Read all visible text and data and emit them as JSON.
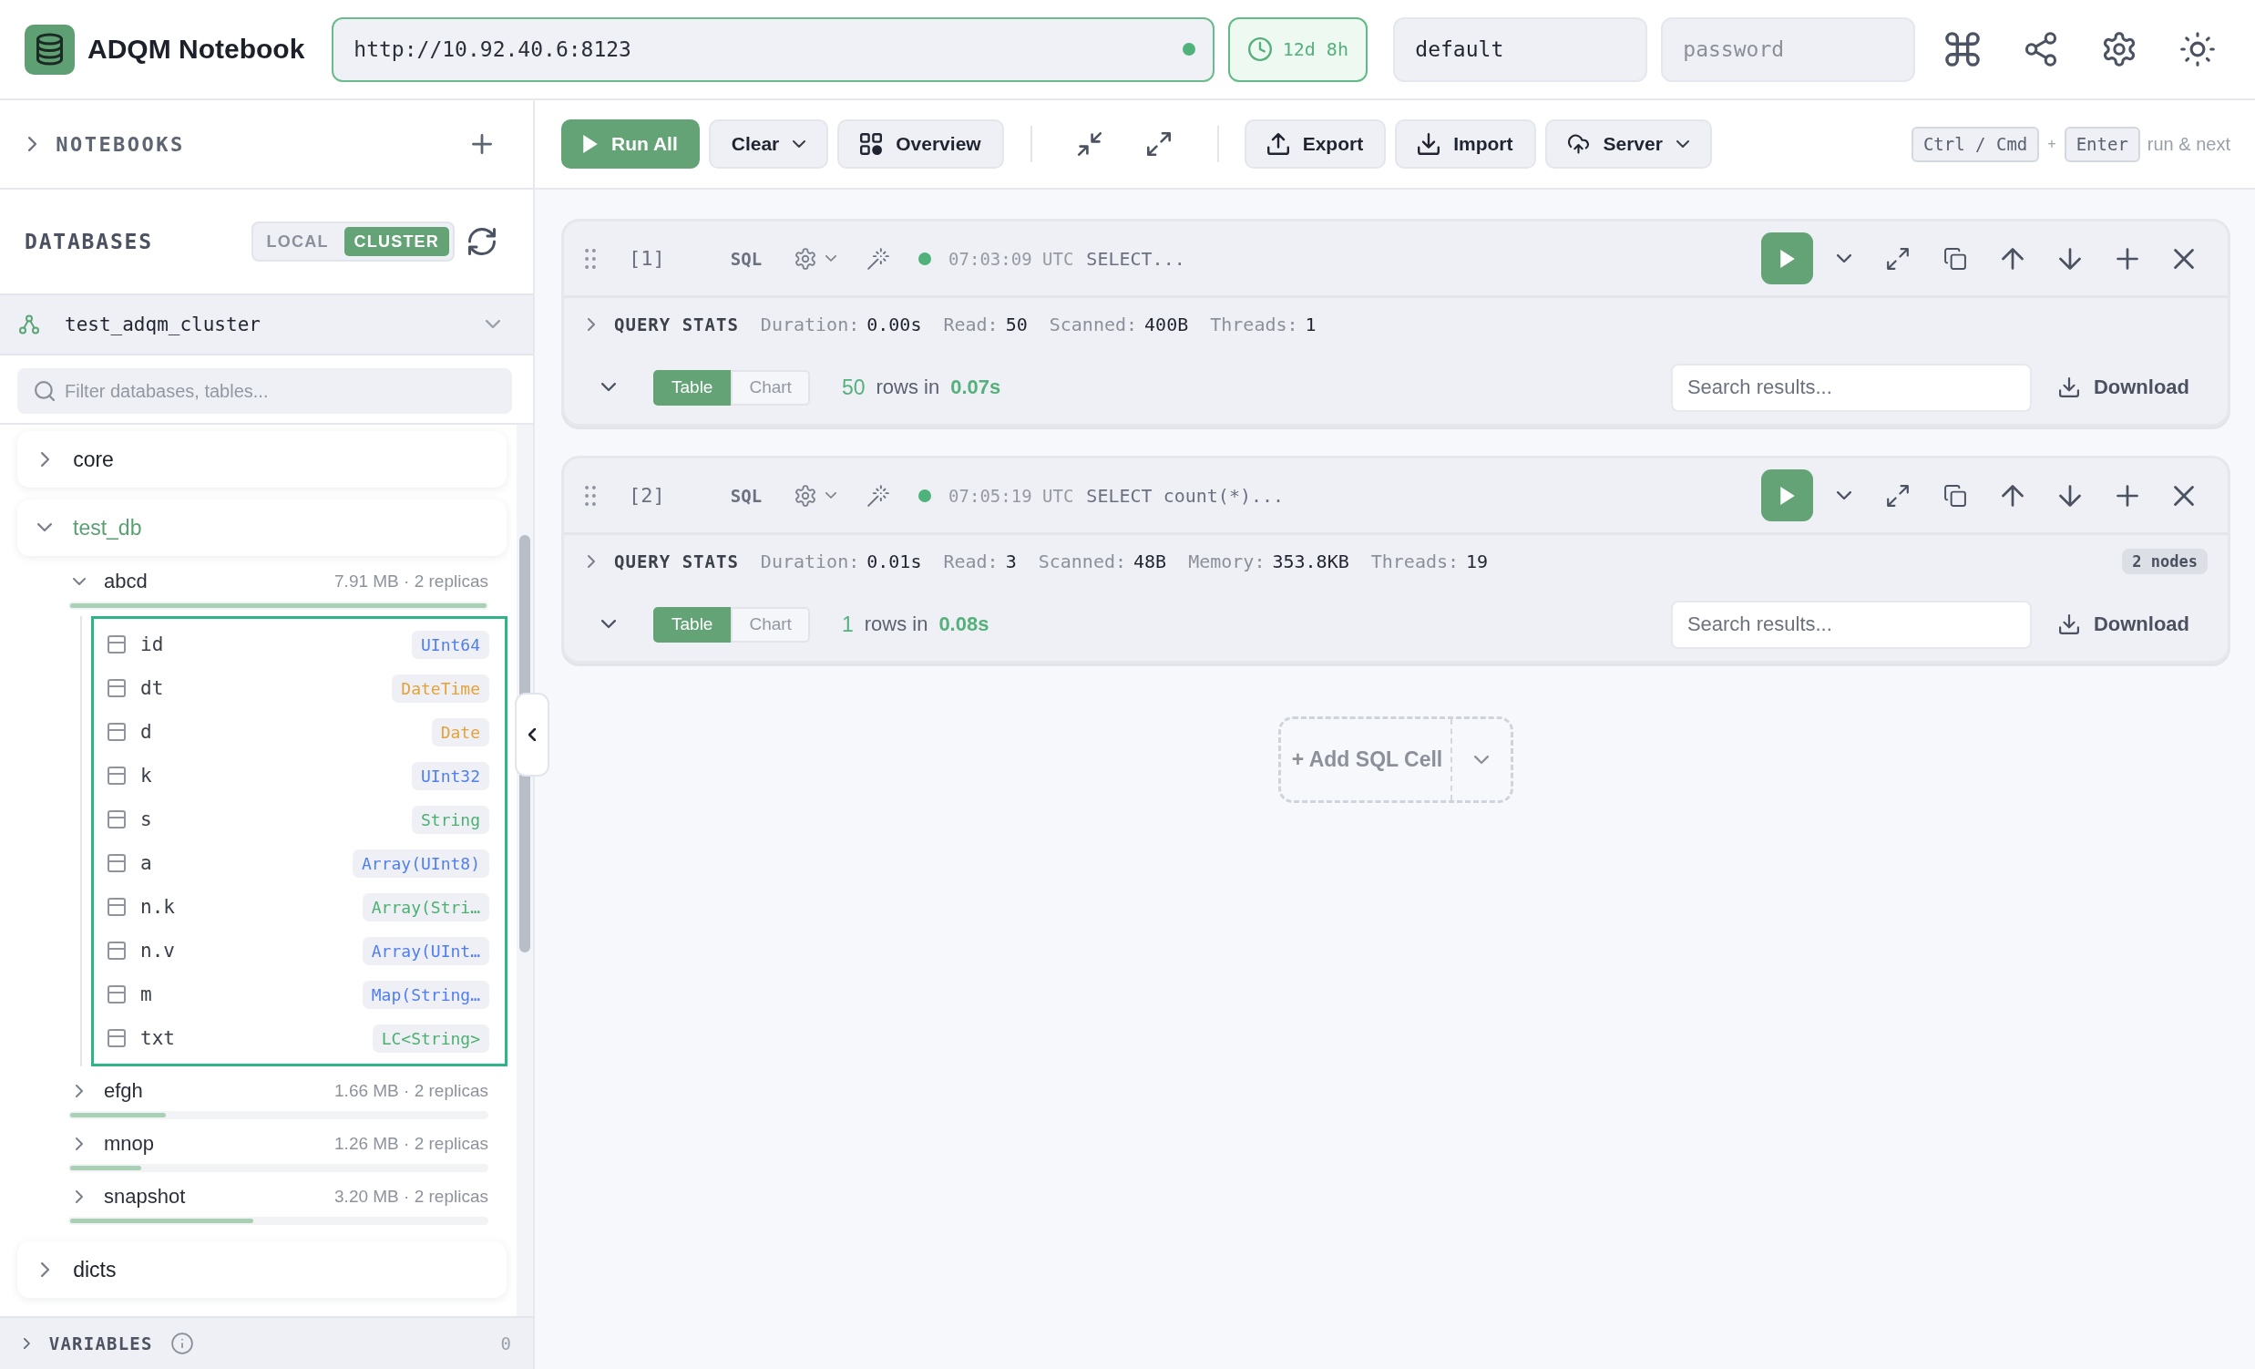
{
  "app": {
    "title": "ADQM Notebook"
  },
  "connection": {
    "url": "http://10.92.40.6:8123",
    "connected": true,
    "uptime": "12d 8h",
    "user": "default",
    "password": {
      "placeholder": "password"
    }
  },
  "sidebar": {
    "notebooks": {
      "label": "NOTEBOOKS",
      "expanded": false
    },
    "databases": {
      "label": "DATABASES",
      "modes": [
        {
          "label": "LOCAL",
          "selected": false
        },
        {
          "label": "CLUSTER",
          "selected": true
        }
      ]
    },
    "cluster": "test_adqm_cluster",
    "filter": {
      "placeholder": "Filter databases, tables..."
    },
    "tree": [
      {
        "name": "core",
        "expanded": false
      },
      {
        "name": "test_db",
        "expanded": true,
        "children": [
          {
            "name": "abcd",
            "meta": "7.91 MB · 2 replicas",
            "level": 1,
            "expanded": true,
            "focused": true,
            "children": [
              {
                "name": "id",
                "type": "UInt64",
                "color": "#4f7ef0"
              },
              {
                "name": "dt",
                "type": "DateTime",
                "color": "#e3a23b"
              },
              {
                "name": "d",
                "type": "Date",
                "color": "#e3a23b"
              },
              {
                "name": "k",
                "type": "UInt32",
                "color": "#4f7ef0"
              },
              {
                "name": "s",
                "type": "String",
                "color": "#4cb070"
              },
              {
                "name": "a",
                "type": "Array(UInt8)",
                "color": "#4f7ef0"
              },
              {
                "name": "n.k",
                "type": "Array(Stri…",
                "color": "#4cb070"
              },
              {
                "name": "n.v",
                "type": "Array(UInt…",
                "color": "#4f7ef0"
              },
              {
                "name": "m",
                "type": "Map(String…",
                "color": "#4f7ef0"
              },
              {
                "name": "txt",
                "type": "LC<String>",
                "color": "#4cb070"
              }
            ]
          },
          {
            "name": "efgh",
            "meta": "1.66 MB · 2 replicas",
            "level": 0.23,
            "expanded": false,
            "focused": false
          },
          {
            "name": "mnop",
            "meta": "1.26 MB · 2 replicas",
            "level": 0.17,
            "expanded": false,
            "focused": false
          },
          {
            "name": "snapshot",
            "meta": "3.20 MB · 2 replicas",
            "level": 0.44,
            "expanded": false,
            "focused": false
          }
        ]
      },
      {
        "name": "dicts",
        "expanded": false
      }
    ],
    "variables": {
      "label": "VARIABLES",
      "expanded": false,
      "count": "0"
    }
  },
  "toolbar": {
    "groups": [
      {
        "buttons": [
          {
            "kind": "run",
            "label": "Run All",
            "has_menu": false
          },
          {
            "kind": "clear",
            "label": "Clear",
            "has_menu": true
          },
          {
            "kind": "overview",
            "label": "Overview",
            "has_menu": false
          }
        ]
      },
      {
        "buttons": [
          {
            "kind": "collapse",
            "has_menu": false
          },
          {
            "kind": "expand",
            "has_menu": false
          }
        ]
      },
      {
        "buttons": [
          {
            "kind": "export",
            "label": "Export",
            "has_menu": false
          },
          {
            "kind": "import",
            "label": "Import",
            "has_menu": false
          },
          {
            "kind": "server",
            "label": "Server",
            "has_menu": true
          }
        ]
      }
    ],
    "shortcut": {
      "keys": [
        "Ctrl / Cmd",
        "Enter"
      ],
      "joiner": "+",
      "action": "run & next"
    }
  },
  "cells": [
    {
      "index": "[1]",
      "language": "SQL",
      "success": true,
      "time": "07:03:09 UTC",
      "preview": "SELECT...",
      "stats": {
        "label": "QUERY STATS",
        "expanded": false,
        "items": [
          {
            "label": "Duration:",
            "value": "0.00s"
          },
          {
            "label": "Read:",
            "value": "50"
          },
          {
            "label": "Scanned:",
            "value": "400B"
          },
          {
            "label": "Threads:",
            "value": "1"
          }
        ]
      },
      "results": {
        "expanded": true,
        "views": [
          {
            "label": "Table",
            "selected": true
          },
          {
            "label": "Chart",
            "selected": false
          }
        ],
        "row_count": "50",
        "rows_label": "rows in",
        "elapsed": "0.07s",
        "search": {
          "placeholder": "Search results..."
        },
        "download": "Download"
      }
    },
    {
      "index": "[2]",
      "language": "SQL",
      "success": true,
      "time": "07:05:19 UTC",
      "preview": "SELECT count(*)...",
      "stats": {
        "label": "QUERY STATS",
        "expanded": false,
        "items": [
          {
            "label": "Duration:",
            "value": "0.01s"
          },
          {
            "label": "Read:",
            "value": "3"
          },
          {
            "label": "Scanned:",
            "value": "48B"
          },
          {
            "label": "Memory:",
            "value": "353.8KB"
          },
          {
            "label": "Threads:",
            "value": "19"
          }
        ],
        "badge": "2 nodes"
      },
      "results": {
        "expanded": true,
        "views": [
          {
            "label": "Table",
            "selected": true
          },
          {
            "label": "Chart",
            "selected": false
          }
        ],
        "row_count": "1",
        "rows_label": "rows in",
        "elapsed": "0.08s",
        "search": {
          "placeholder": "Search results..."
        },
        "download": "Download"
      }
    }
  ],
  "add_cell": {
    "label": "+ Add SQL Cell"
  }
}
